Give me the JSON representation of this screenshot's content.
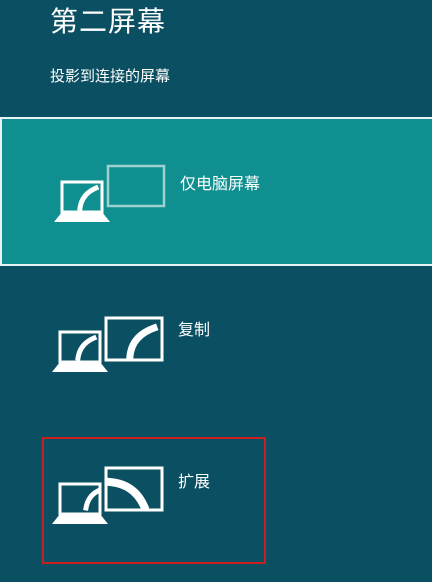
{
  "panel": {
    "title": "第二屏幕",
    "subtitle": "投影到连接的屏幕"
  },
  "options": [
    {
      "label": "仅电脑屏幕",
      "icon": "pc-screen-only-icon",
      "selected": true
    },
    {
      "label": "复制",
      "icon": "duplicate-icon",
      "selected": false
    },
    {
      "label": "扩展",
      "icon": "extend-icon",
      "selected": false
    }
  ],
  "colors": {
    "background": "#0b4f62",
    "selected": "#0f8f8f",
    "annotation": "#c8201e"
  }
}
